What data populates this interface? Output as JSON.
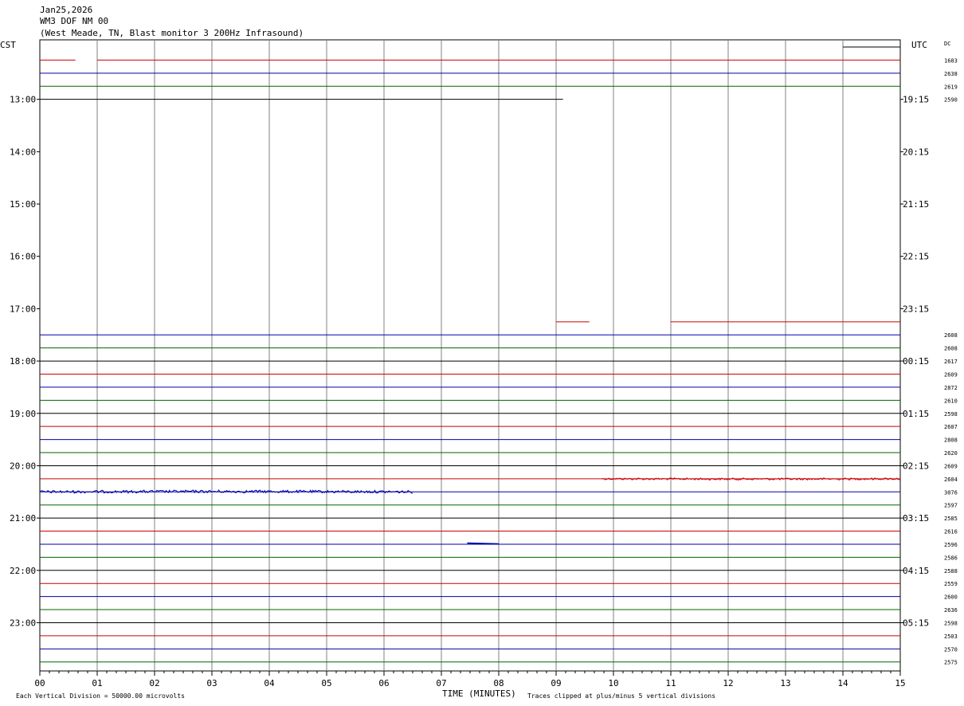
{
  "header": {
    "date": "Jan25,2026",
    "station": "WM3 DOF NM 00",
    "description": "(West Meade, TN, Blast monitor 3 200Hz Infrasound)"
  },
  "left_axis_label": "CST",
  "right_axis_label": "UTC",
  "dc_label": "DC",
  "footer": {
    "left_note": "Each Vertical Division = 50000.00 microvolts",
    "xlabel": "TIME (MINUTES)",
    "right_note": "Traces clipped at plus/minus 5 vertical divisions"
  },
  "colors": {
    "black": "#000000",
    "red": "#cc0000",
    "blue": "#0000aa",
    "green": "#006600",
    "grid": "#808080"
  },
  "chart_data": {
    "type": "line",
    "title": "Jan25,2026 WM3 DOF NM 00 (West Meade, TN, Blast monitor 3 200Hz Infrasound)",
    "xlabel": "TIME (MINUTES)",
    "x_ticks": [
      "00",
      "01",
      "02",
      "03",
      "04",
      "05",
      "06",
      "07",
      "08",
      "09",
      "10",
      "11",
      "12",
      "13",
      "14",
      "15"
    ],
    "xlim": [
      0,
      15
    ],
    "grid": true,
    "trace_minutes": 15,
    "color_cycle": [
      "black",
      "red",
      "blue",
      "green"
    ],
    "left_hour_labels": [
      {
        "row": 4,
        "label": "13:00"
      },
      {
        "row": 8,
        "label": "14:00"
      },
      {
        "row": 12,
        "label": "15:00"
      },
      {
        "row": 16,
        "label": "16:00"
      },
      {
        "row": 20,
        "label": "17:00"
      },
      {
        "row": 24,
        "label": "18:00"
      },
      {
        "row": 28,
        "label": "19:00"
      },
      {
        "row": 32,
        "label": "20:00"
      },
      {
        "row": 36,
        "label": "21:00"
      },
      {
        "row": 40,
        "label": "22:00"
      },
      {
        "row": 44,
        "label": "23:00"
      }
    ],
    "right_hour_labels": [
      {
        "row": 4,
        "label": "19:15"
      },
      {
        "row": 8,
        "label": "20:15"
      },
      {
        "row": 12,
        "label": "21:15"
      },
      {
        "row": 16,
        "label": "22:15"
      },
      {
        "row": 20,
        "label": "23:15"
      },
      {
        "row": 24,
        "label": "00:15"
      },
      {
        "row": 28,
        "label": "01:15"
      },
      {
        "row": 32,
        "label": "02:15"
      },
      {
        "row": 36,
        "label": "03:15"
      },
      {
        "row": 40,
        "label": "04:15"
      },
      {
        "row": 44,
        "label": "05:15"
      }
    ],
    "traces": [
      {
        "row": 0,
        "dc": "",
        "segments": [
          [
            14.0,
            15.0
          ]
        ],
        "noise": 0
      },
      {
        "row": 1,
        "dc": "1683",
        "segments": [
          [
            0.0,
            0.62
          ],
          [
            1.0,
            15.0
          ]
        ],
        "noise": 0
      },
      {
        "row": 2,
        "dc": "2638",
        "segments": [
          [
            0.0,
            15.0
          ]
        ],
        "noise": 0
      },
      {
        "row": 3,
        "dc": "2619",
        "segments": [
          [
            0.0,
            15.0
          ]
        ],
        "noise": 0
      },
      {
        "row": 4,
        "dc": "2590",
        "segments": [
          [
            0.0,
            9.12
          ]
        ],
        "noise": 0
      },
      {
        "row": 21,
        "dc": "",
        "segments": [
          [
            9.0,
            9.58
          ],
          [
            11.0,
            15.0
          ]
        ],
        "noise": 0
      },
      {
        "row": 22,
        "dc": "2608",
        "segments": [
          [
            0.0,
            15.0
          ]
        ],
        "noise": 0
      },
      {
        "row": 23,
        "dc": "2608",
        "segments": [
          [
            0.0,
            15.0
          ]
        ],
        "noise": 0
      },
      {
        "row": 24,
        "dc": "2617",
        "segments": [
          [
            0.0,
            15.0
          ]
        ],
        "noise": 0
      },
      {
        "row": 25,
        "dc": "2609",
        "segments": [
          [
            0.0,
            15.0
          ]
        ],
        "noise": 0
      },
      {
        "row": 26,
        "dc": "2872",
        "segments": [
          [
            0.0,
            15.0
          ]
        ],
        "noise": 0
      },
      {
        "row": 27,
        "dc": "2610",
        "segments": [
          [
            0.0,
            15.0
          ]
        ],
        "noise": 0
      },
      {
        "row": 28,
        "dc": "2598",
        "segments": [
          [
            0.0,
            15.0
          ]
        ],
        "noise": 0
      },
      {
        "row": 29,
        "dc": "2607",
        "segments": [
          [
            0.0,
            15.0
          ]
        ],
        "noise": 0
      },
      {
        "row": 30,
        "dc": "2808",
        "segments": [
          [
            0.0,
            15.0
          ]
        ],
        "noise": 0
      },
      {
        "row": 31,
        "dc": "2620",
        "segments": [
          [
            0.0,
            15.0
          ]
        ],
        "noise": 0
      },
      {
        "row": 32,
        "dc": "2609",
        "segments": [
          [
            0.0,
            15.0
          ]
        ],
        "noise": 0
      },
      {
        "row": 33,
        "dc": "2604",
        "segments": [
          [
            0.0,
            15.0
          ]
        ],
        "noise": 0,
        "noisy": [
          [
            9.8,
            15.0,
            2.5,
            0.3
          ]
        ]
      },
      {
        "row": 34,
        "dc": "3076",
        "segments": [
          [
            0.0,
            15.0
          ]
        ],
        "noise": 0,
        "noisy": [
          [
            0.0,
            6.5,
            3.5,
            -0.5
          ]
        ]
      },
      {
        "row": 35,
        "dc": "2597",
        "segments": [
          [
            0.0,
            15.0
          ]
        ],
        "noise": 0
      },
      {
        "row": 36,
        "dc": "2585",
        "segments": [
          [
            0.0,
            15.0
          ]
        ],
        "noise": 0
      },
      {
        "row": 37,
        "dc": "2616",
        "segments": [
          [
            0.0,
            15.0
          ]
        ],
        "noise": 0
      },
      {
        "row": 38,
        "dc": "2596",
        "segments": [
          [
            0.0,
            15.0
          ]
        ],
        "noise": 0,
        "bumps": [
          [
            7.45,
            8.0,
            -1.5
          ]
        ]
      },
      {
        "row": 39,
        "dc": "2586",
        "segments": [
          [
            0.0,
            15.0
          ]
        ],
        "noise": 0
      },
      {
        "row": 40,
        "dc": "2588",
        "segments": [
          [
            0.0,
            15.0
          ]
        ],
        "noise": 0
      },
      {
        "row": 41,
        "dc": "2559",
        "segments": [
          [
            0.0,
            15.0
          ]
        ],
        "noise": 0
      },
      {
        "row": 42,
        "dc": "2600",
        "segments": [
          [
            0.0,
            15.0
          ]
        ],
        "noise": 0
      },
      {
        "row": 43,
        "dc": "2636",
        "segments": [
          [
            0.0,
            15.0
          ]
        ],
        "noise": 0
      },
      {
        "row": 44,
        "dc": "2598",
        "segments": [
          [
            0.0,
            15.0
          ]
        ],
        "noise": 0
      },
      {
        "row": 45,
        "dc": "2503",
        "segments": [
          [
            0.0,
            15.0
          ]
        ],
        "noise": 0
      },
      {
        "row": 46,
        "dc": "2570",
        "segments": [
          [
            0.0,
            15.0
          ]
        ],
        "noise": 0
      },
      {
        "row": 47,
        "dc": "2575",
        "segments": [
          [
            0.0,
            15.0
          ]
        ],
        "noise": 0
      }
    ]
  }
}
